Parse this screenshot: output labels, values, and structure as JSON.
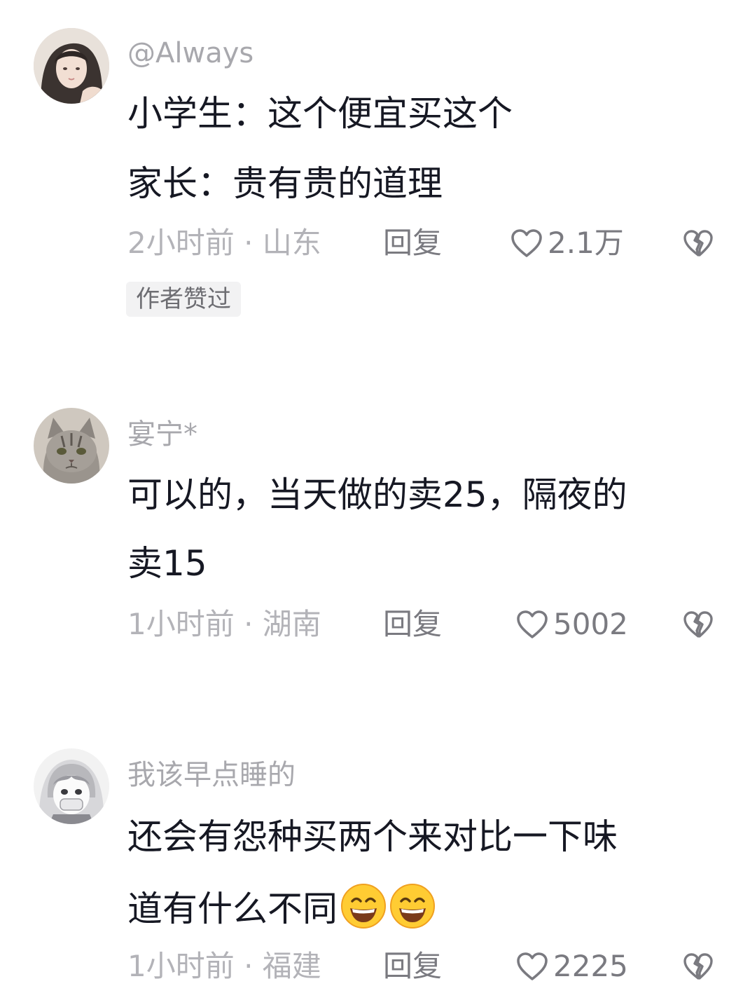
{
  "comments": [
    {
      "username": "@Always",
      "lines": [
        "小学生：这个便宜买这个",
        "家长：贵有贵的道理"
      ],
      "meta": "2小时前 · 山东",
      "reply_label": "回复",
      "likes": "2.1万",
      "badge": "作者赞过",
      "avatar_icon": "girl-avatar"
    },
    {
      "username": "宴宁*",
      "lines": [
        "可以的，当天做的卖25，隔夜的",
        "卖15"
      ],
      "meta": "1小时前 · 湖南",
      "reply_label": "回复",
      "likes": "5002",
      "avatar_icon": "cat-avatar"
    },
    {
      "username": "我该早点睡的",
      "lines": [
        "还会有怨种买两个来对比一下味",
        "道有什么不同"
      ],
      "meta": "1小时前 · 福建",
      "reply_label": "回复",
      "likes": "2225",
      "emojis": [
        "grinning-face-emoji",
        "grinning-face-emoji"
      ],
      "avatar_icon": "anime-avatar"
    }
  ],
  "colors": {
    "username": "#a8a8ad",
    "text": "#161823",
    "meta": "#b3b3b8",
    "action": "#7a7a80",
    "badge_bg": "#f2f2f3"
  }
}
